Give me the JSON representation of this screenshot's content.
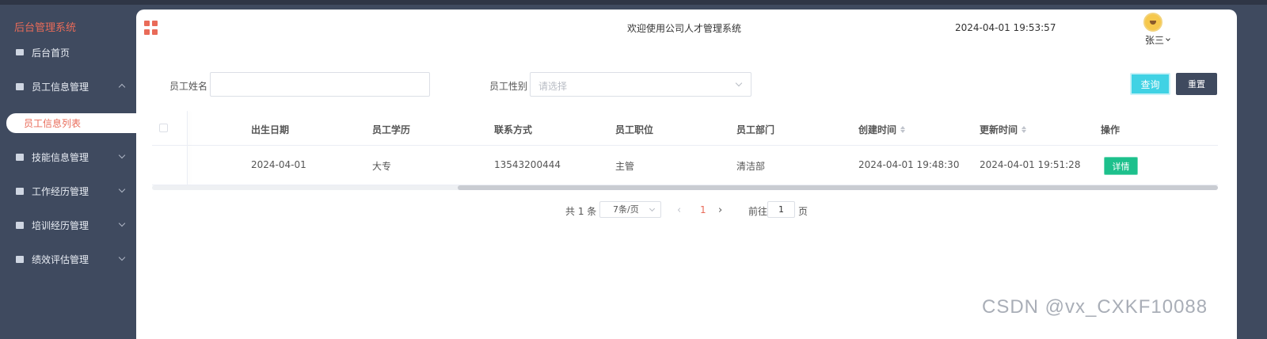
{
  "sidebar": {
    "brand": "后台管理系统",
    "items": [
      {
        "label": "后台首页"
      },
      {
        "label": "员工信息管理"
      },
      {
        "label": "技能信息管理"
      },
      {
        "label": "工作经历管理"
      },
      {
        "label": "培训经历管理"
      },
      {
        "label": "绩效评估管理"
      }
    ],
    "active_sub": "员工信息列表"
  },
  "header": {
    "welcome": "欢迎使用公司人才管理系统",
    "datetime": "2024-04-01 19:53:57",
    "username": "张三"
  },
  "search": {
    "name_label": "员工姓名",
    "name_value": "",
    "gender_label": "员工性别",
    "gender_placeholder": "请选择",
    "query_label": "查询",
    "reset_label": "重置"
  },
  "table": {
    "columns": [
      "出生日期",
      "员工学历",
      "联系方式",
      "员工职位",
      "员工部门",
      "创建时间",
      "更新时间",
      "操作"
    ],
    "rows": [
      {
        "birth": "2024-04-01",
        "education": "大专",
        "phone": "13543200444",
        "position": "主管",
        "department": "清洁部",
        "created": "2024-04-01 19:48:30",
        "updated": "2024-04-01 19:51:28",
        "action": "详情"
      }
    ]
  },
  "pagination": {
    "total": "共 1 条",
    "page_size": "7条/页",
    "current": "1",
    "goto_prefix": "前往",
    "goto_value": "1",
    "goto_suffix": "页"
  },
  "watermark": "CSDN @vx_CXKF10088",
  "colors": {
    "sidebar_bg": "#3f4a5f",
    "accent": "#e96b59",
    "query_button": "#40d2e4",
    "detail_button": "#1dc08c"
  }
}
